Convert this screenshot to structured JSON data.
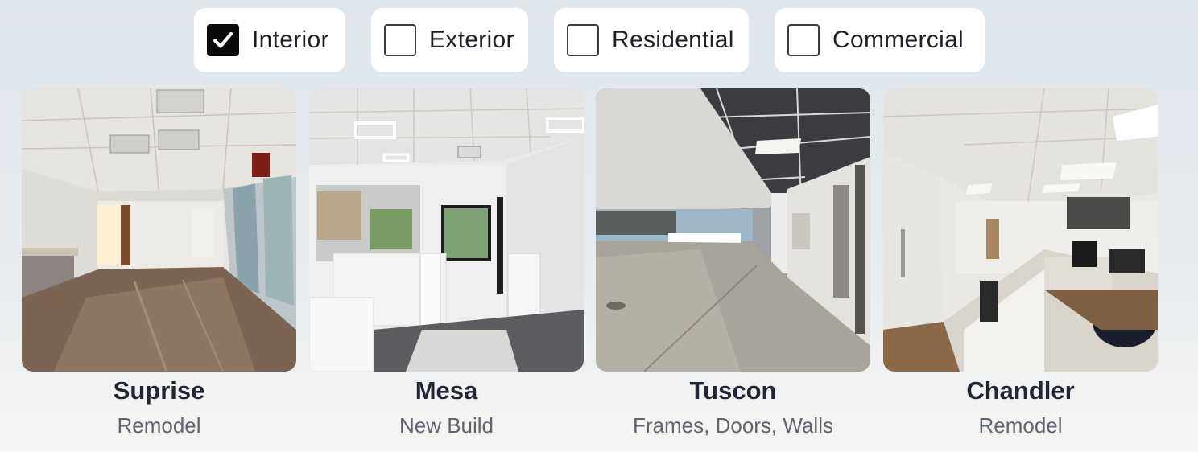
{
  "filters": [
    {
      "label": "Interior",
      "checked": true
    },
    {
      "label": "Exterior",
      "checked": false
    },
    {
      "label": "Residential",
      "checked": false
    },
    {
      "label": "Commercial",
      "checked": false
    }
  ],
  "projects": [
    {
      "city": "Suprise",
      "type": "Remodel"
    },
    {
      "city": "Mesa",
      "type": "New Build"
    },
    {
      "city": "Tuscon",
      "type": "Frames, Doors, Walls"
    },
    {
      "city": "Chandler",
      "type": "Remodel"
    }
  ],
  "colors": {
    "checkbox_checked": "#0b0b0d",
    "card_background": "#ffffff",
    "title_text": "#1f2532",
    "subtitle_text": "#5e6470"
  }
}
